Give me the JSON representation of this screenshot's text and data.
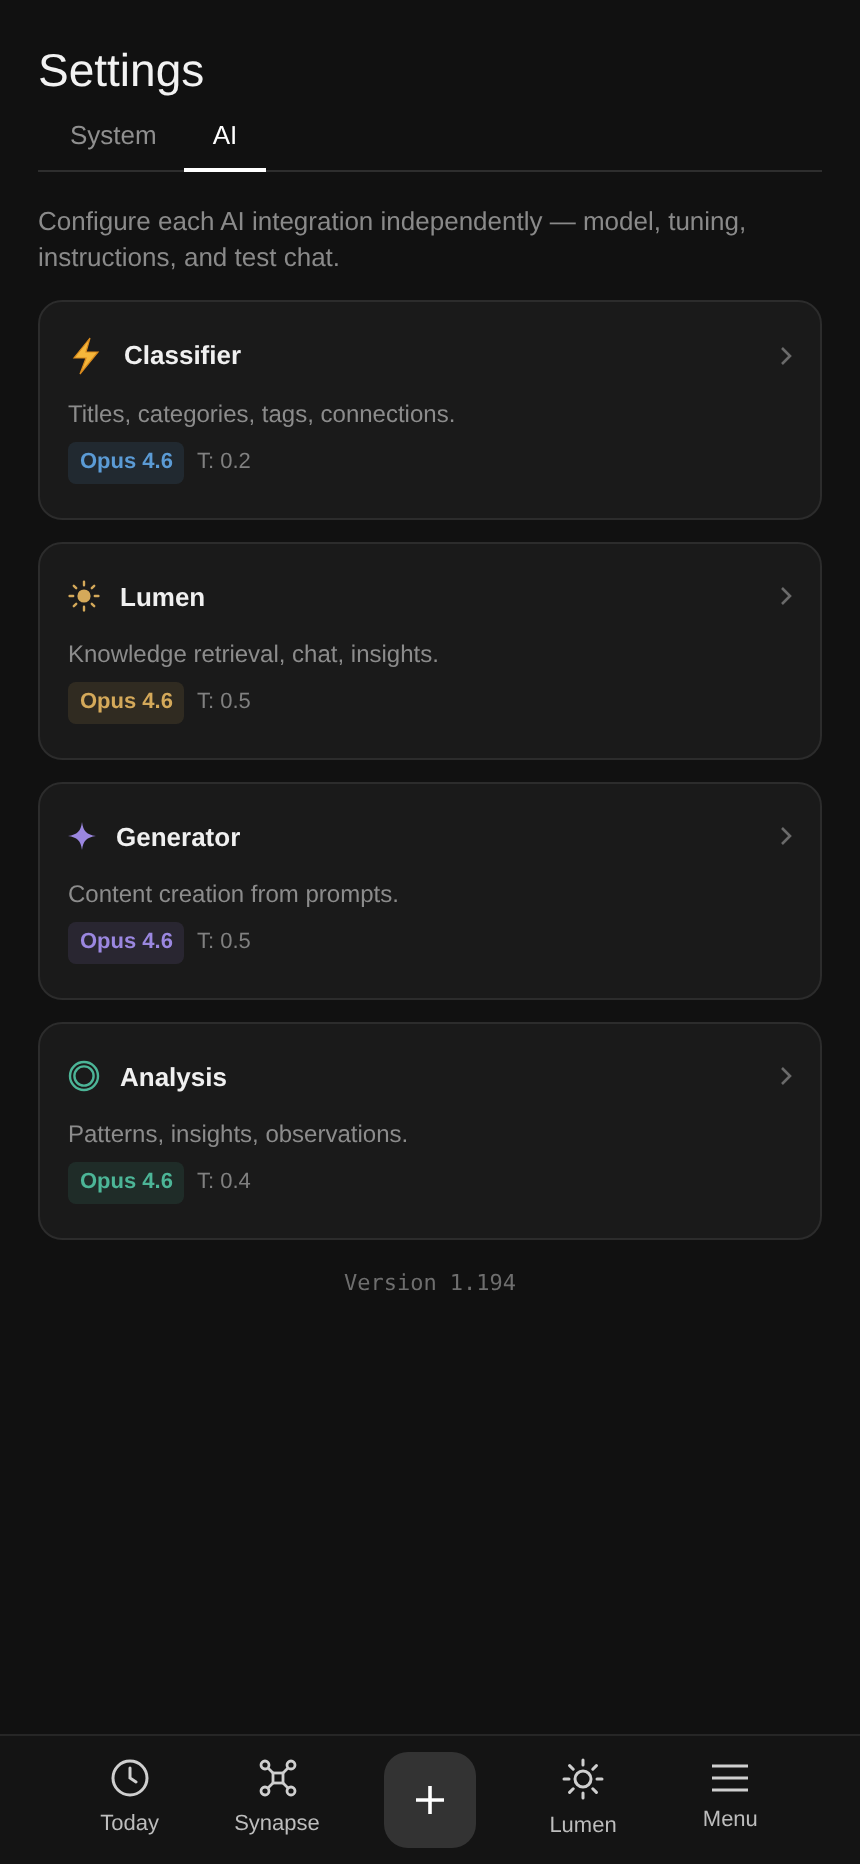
{
  "title": "Settings",
  "tabs": [
    {
      "label": "System",
      "selected": false
    },
    {
      "label": "AI",
      "selected": true
    }
  ],
  "intro": "Configure each AI integration independently — model, tuning, instructions, and test chat.",
  "integrations": [
    {
      "kind": "bolt",
      "name": "Classifier",
      "description": "Titles, categories, tags, connections.",
      "model": "Opus 4.6",
      "temperature": "T: 0.2",
      "color": "#5b9bd5"
    },
    {
      "kind": "sun",
      "name": "Lumen",
      "description": "Knowledge retrieval, chat, insights.",
      "model": "Opus 4.6",
      "temperature": "T: 0.5",
      "color": "#d4a95a"
    },
    {
      "kind": "sparkle",
      "name": "Generator",
      "description": "Content creation from prompts.",
      "model": "Opus 4.6",
      "temperature": "T: 0.5",
      "color": "#9b87e0"
    },
    {
      "kind": "ring",
      "name": "Analysis",
      "description": "Patterns, insights, observations.",
      "model": "Opus 4.6",
      "temperature": "T: 0.4",
      "color": "#4cb597"
    }
  ],
  "version": "Version 1.194",
  "nav": [
    {
      "kind": "clock",
      "label": "Today"
    },
    {
      "kind": "network",
      "label": "Synapse"
    },
    {
      "kind": "add"
    },
    {
      "kind": "sun",
      "label": "Lumen"
    },
    {
      "kind": "menu",
      "label": "Menu"
    }
  ]
}
